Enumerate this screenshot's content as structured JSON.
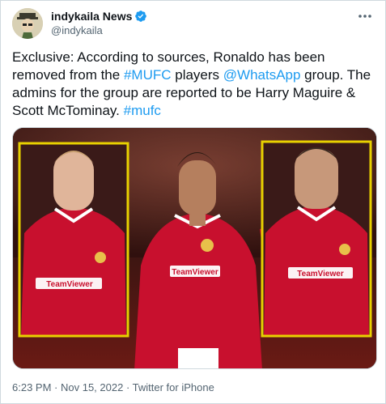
{
  "author": {
    "display_name": "indykaila News",
    "handle": "@indykaila",
    "verified": true,
    "avatar_icon": "cartoon-avatar"
  },
  "menu_icon": "more-horizontal-icon",
  "tweet": {
    "segments": [
      {
        "text": "Exclusive: According to sources, Ronaldo has been removed from the ",
        "link": false
      },
      {
        "text": "#MUFC",
        "link": true
      },
      {
        "text": " players ",
        "link": false
      },
      {
        "text": "@WhatsApp",
        "link": true
      },
      {
        "text": " group. The admins for the group are reported to be Harry Maguire & Scott McTominay. ",
        "link": false
      },
      {
        "text": "#mufc",
        "link": true
      }
    ]
  },
  "media": {
    "description_icon": "photo-collage",
    "highlight_color": "#e8d100",
    "shirt_color": "#c8102e",
    "sponsor_text": "TeamViewer"
  },
  "meta": {
    "time": "6:23 PM",
    "sep1": " · ",
    "date": "Nov 15, 2022",
    "sep2": " · ",
    "source": "Twitter for iPhone"
  },
  "colors": {
    "link": "#1d9bf0",
    "text": "#0f1419",
    "muted": "#536471",
    "verified": "#1d9bf0"
  }
}
